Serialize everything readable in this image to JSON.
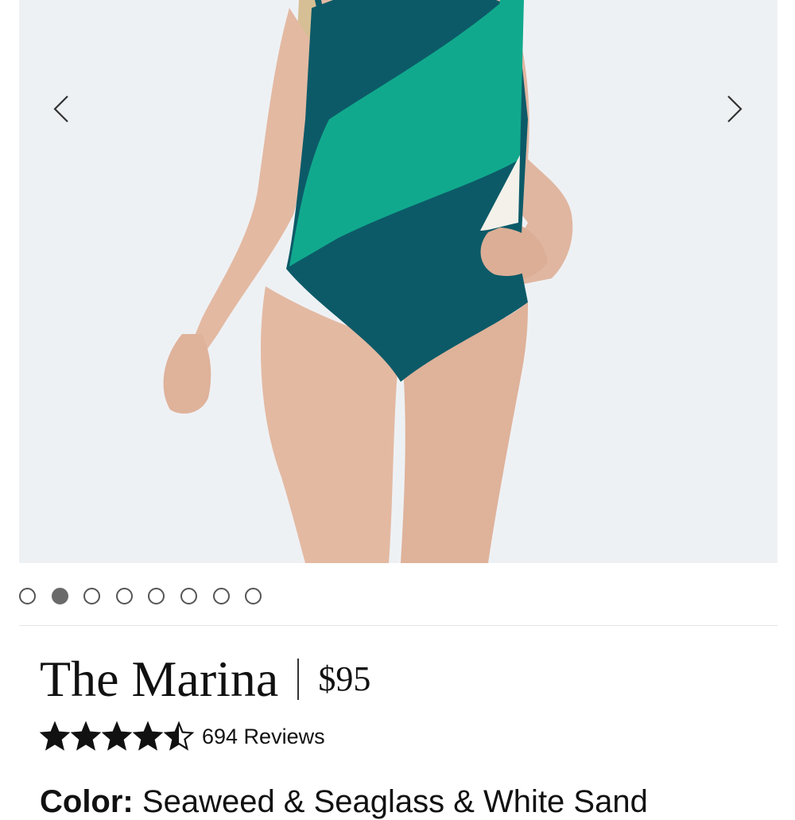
{
  "product": {
    "title": "The Marina",
    "price": "$95",
    "rating": 4.5,
    "rating_max": 5,
    "reviews_text": "694 Reviews",
    "color_label": "Color:",
    "color_value": "Seaweed & Seaglass & White Sand"
  },
  "gallery": {
    "image_count": 8,
    "active_index": 1,
    "prev_icon": "chevron-left-icon",
    "next_icon": "chevron-right-icon"
  },
  "colors": {
    "seaglass": "#11a98d",
    "seaweed": "#0c5a68",
    "white_sand": "#f3f1ea",
    "star": "#111111",
    "dot_active": "#6a6a6a"
  }
}
